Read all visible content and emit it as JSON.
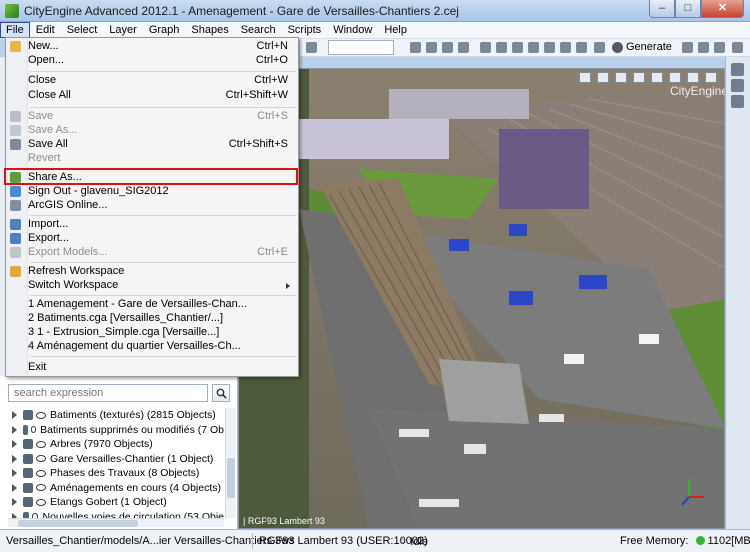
{
  "window": {
    "title": "CityEngine Advanced 2012.1 - Amenagement - Gare de Versailles-Chantiers 2.cej"
  },
  "menubar": [
    "File",
    "Edit",
    "Select",
    "Layer",
    "Graph",
    "Shapes",
    "Search",
    "Scripts",
    "Window",
    "Help"
  ],
  "toolbar": {
    "generate_label": "Generate"
  },
  "file_menu": {
    "new": {
      "label": "New...",
      "shortcut": "Ctrl+N"
    },
    "open": {
      "label": "Open...",
      "shortcut": "Ctrl+O"
    },
    "close": {
      "label": "Close",
      "shortcut": "Ctrl+W"
    },
    "close_all": {
      "label": "Close All",
      "shortcut": "Ctrl+Shift+W"
    },
    "save": {
      "label": "Save",
      "shortcut": "Ctrl+S"
    },
    "save_as": {
      "label": "Save As..."
    },
    "save_all": {
      "label": "Save All",
      "shortcut": "Ctrl+Shift+S"
    },
    "revert": {
      "label": "Revert"
    },
    "share_as": {
      "label": "Share As..."
    },
    "sign_out": {
      "label": "Sign Out - glavenu_SIG2012"
    },
    "arcgis_online": {
      "label": "ArcGIS Online..."
    },
    "import": {
      "label": "Import..."
    },
    "export": {
      "label": "Export..."
    },
    "export_models": {
      "label": "Export Models...",
      "shortcut": "Ctrl+E"
    },
    "refresh_workspace": {
      "label": "Refresh Workspace"
    },
    "switch_workspace": {
      "label": "Switch Workspace"
    },
    "recent": [
      "1 Amenagement - Gare de Versailles-Chan...",
      "2 Batiments.cga  [Versailles_Chantier/...]",
      "3 1 - Extrusion_Simple.cga  [Versaille...]",
      "4 Aménagement du quartier Versailles-Ch..."
    ],
    "exit": {
      "label": "Exit"
    }
  },
  "navigator": {
    "search_placeholder": "search expression",
    "layers": [
      "Batiments (texturés) (2815 Objects)",
      "Batiments supprimés ou modifiés (7 Ob",
      "Arbres (7970 Objects)",
      "Gare Versailles-Chantier (1 Object)",
      "Phases des Travaux (8 Objects)",
      "Aménagements en cours (4 Objects)",
      "Etangs Gobert (1 Object)",
      "Nouvelles voies de circulation (53 Obje"
    ]
  },
  "viewport": {
    "brand": "CityEngine",
    "crs_overlay": "| RGF93 Lambert 93"
  },
  "statusbar": {
    "path": "Versailles_Chantier/models/A...ier Versailles-Chantiers.3ws",
    "crs": "RGF93 Lambert 93 (USER:10002)",
    "state": "Idle",
    "memory_label": "Free Memory:",
    "memory_value": "1102[MB]"
  },
  "colors": {
    "highlight": "#e01010",
    "memory_ok": "#2fb52a"
  }
}
